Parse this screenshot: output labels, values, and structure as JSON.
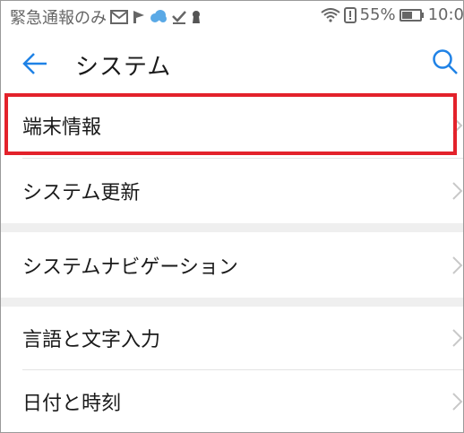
{
  "status_bar": {
    "notification_text": "緊急通報のみ",
    "notification_icons": [
      "mail-icon",
      "flag-icon",
      "cloud-icon",
      "check-icon",
      "keyhole-icon"
    ],
    "battery_percent": "55%",
    "time": "10:0"
  },
  "app_bar": {
    "title": "システム"
  },
  "menu": {
    "items": [
      {
        "label": "端末情報",
        "highlighted": true
      },
      {
        "label": "システム更新"
      },
      {
        "label": "システムナビゲーション"
      },
      {
        "label": "言語と文字入力"
      },
      {
        "label": "日付と時刻"
      }
    ]
  },
  "colors": {
    "accent": "#1f82e6",
    "highlight_border": "#e3222b",
    "section_gap": "#efefef"
  }
}
